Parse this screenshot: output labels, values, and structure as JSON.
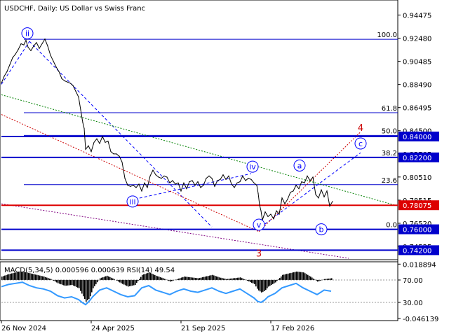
{
  "chart_data": [
    {
      "type": "line",
      "title": "USDCHF, Daily:  US Dollar vs Swiss Franc",
      "symbol": "USDCHF",
      "timeframe": "Daily",
      "ylim": [
        0.735,
        0.9565
      ],
      "y_ticks": [
        "0.94475",
        "0.92480",
        "0.90485",
        "0.88490",
        "0.86495",
        "0.84500",
        "0.82505",
        "0.80510",
        "0.78515",
        "0.76520",
        "0.74525"
      ],
      "x_ticks": [
        "26 Nov 2024",
        "24 Apr 2025",
        "21 Sep 2025",
        "17 Feb 2026"
      ],
      "price_series": {
        "name": "USDCHF",
        "x": [
          0,
          4,
          8,
          12,
          16,
          20,
          24,
          28,
          32,
          35,
          38,
          42,
          46,
          50,
          54,
          58,
          62,
          66,
          70,
          74,
          78,
          82,
          86,
          90,
          94,
          98,
          102,
          106,
          110,
          113,
          116,
          118,
          120,
          124,
          128,
          132,
          136,
          140,
          144,
          148,
          152,
          156,
          160,
          164,
          168,
          172,
          176,
          180,
          184,
          188,
          192,
          196,
          200,
          204,
          208,
          212,
          216,
          220,
          224,
          228,
          232,
          236,
          240,
          244,
          248,
          252,
          256,
          260,
          264,
          268,
          272,
          276,
          280,
          284,
          288,
          292,
          296,
          300,
          304,
          308,
          312,
          316,
          320,
          324,
          328,
          332,
          336,
          340,
          344,
          348,
          352,
          356,
          360,
          364,
          366,
          368,
          370,
          372,
          376,
          380,
          384,
          388,
          392,
          396,
          400,
          404,
          408,
          412,
          416,
          420,
          424,
          428,
          432,
          436,
          440,
          444,
          448,
          452,
          456,
          460,
          464,
          468,
          472
        ],
        "values": [
          0.886,
          0.892,
          0.896,
          0.902,
          0.908,
          0.911,
          0.915,
          0.92,
          0.919,
          0.923,
          0.917,
          0.914,
          0.918,
          0.921,
          0.916,
          0.92,
          0.924,
          0.918,
          0.91,
          0.905,
          0.9,
          0.896,
          0.89,
          0.888,
          0.887,
          0.886,
          0.884,
          0.879,
          0.874,
          0.863,
          0.852,
          0.847,
          0.829,
          0.832,
          0.827,
          0.835,
          0.838,
          0.834,
          0.84,
          0.835,
          0.836,
          0.827,
          0.825,
          0.825,
          0.823,
          0.818,
          0.804,
          0.798,
          0.797,
          0.798,
          0.796,
          0.799,
          0.793,
          0.8,
          0.796,
          0.806,
          0.811,
          0.807,
          0.805,
          0.804,
          0.806,
          0.805,
          0.8,
          0.802,
          0.799,
          0.8,
          0.793,
          0.8,
          0.795,
          0.801,
          0.802,
          0.798,
          0.801,
          0.796,
          0.798,
          0.804,
          0.806,
          0.804,
          0.797,
          0.802,
          0.803,
          0.807,
          0.803,
          0.806,
          0.799,
          0.796,
          0.8,
          0.801,
          0.806,
          0.802,
          0.804,
          0.803,
          0.8,
          0.798,
          0.791,
          0.781,
          0.776,
          0.768,
          0.775,
          0.771,
          0.773,
          0.769,
          0.776,
          0.773,
          0.787,
          0.782,
          0.786,
          0.792,
          0.793,
          0.798,
          0.795,
          0.801,
          0.8,
          0.806,
          0.802,
          0.805,
          0.79,
          0.787,
          0.794,
          0.788,
          0.793,
          0.78,
          0.784
        ]
      },
      "horizontal_levels": [
        {
          "value": 0.84,
          "label": "0.84000",
          "color": "#0000cc",
          "weight": "bold"
        },
        {
          "value": 0.822,
          "label": "0.82200",
          "color": "#0000cc",
          "weight": "bold"
        },
        {
          "value": 0.78075,
          "label": "0.78075",
          "color": "#dd0000",
          "weight": "bold"
        },
        {
          "value": 0.76,
          "label": "0.76000",
          "color": "#0000cc",
          "weight": "bold"
        },
        {
          "value": 0.742,
          "label": "0.74200",
          "color": "#0000cc",
          "weight": "bold"
        }
      ],
      "fibonacci_levels": [
        {
          "label": "100.0",
          "value": 0.9238
        },
        {
          "label": "61.8",
          "value": 0.8605
        },
        {
          "label": "50.0",
          "value": 0.841
        },
        {
          "label": "38.2",
          "value": 0.822
        },
        {
          "label": "23.6",
          "value": 0.7985
        },
        {
          "label": "0.0",
          "value": 0.76
        }
      ],
      "wave_labels": [
        {
          "text": "ii",
          "x": 37,
          "value": 0.929,
          "style": "circle-blue"
        },
        {
          "text": "iii",
          "x": 187,
          "value": 0.784,
          "style": "circle-blue"
        },
        {
          "text": "iv",
          "x": 358,
          "value": 0.814,
          "style": "circle-blue"
        },
        {
          "text": "v",
          "x": 367,
          "value": 0.764,
          "style": "circle-blue"
        },
        {
          "text": "a",
          "x": 425,
          "value": 0.815,
          "style": "circle-blue"
        },
        {
          "text": "b",
          "x": 456,
          "value": 0.76,
          "style": "circle-blue"
        },
        {
          "text": "c",
          "x": 512,
          "value": 0.834,
          "style": "circle-blue"
        },
        {
          "text": "3",
          "x": 367,
          "value": 0.7395,
          "style": "plain-red"
        },
        {
          "text": "4",
          "x": 512,
          "value": 0.848,
          "style": "plain-red"
        }
      ]
    },
    {
      "type": "line",
      "title": "MACD(5,34,5) 0.000596 0.000639 RSI(14) 49.54",
      "ylim": [
        -0.047,
        0.02
      ],
      "y_ticks": [
        "0.018894",
        "70.00",
        "30.00",
        "-0.046139"
      ],
      "macd_histogram": {
        "name": "MACD",
        "x": [
          0,
          10,
          20,
          30,
          40,
          50,
          60,
          70,
          80,
          90,
          100,
          110,
          115,
          120,
          125,
          130,
          140,
          150,
          160,
          170,
          180,
          190,
          200,
          210,
          220,
          230,
          240,
          250,
          260,
          270,
          280,
          290,
          300,
          310,
          320,
          330,
          340,
          350,
          360,
          365,
          370,
          375,
          380,
          390,
          400,
          410,
          420,
          430,
          440,
          450,
          460,
          470
        ],
        "values": [
          0.004,
          0.007,
          0.009,
          0.01,
          0.008,
          0.006,
          0.004,
          0.001,
          -0.004,
          -0.007,
          -0.006,
          -0.01,
          -0.018,
          -0.026,
          -0.022,
          -0.01,
          0.002,
          0.005,
          0.001,
          -0.004,
          -0.008,
          -0.006,
          0.006,
          0.009,
          0.005,
          0.002,
          -0.002,
          0.001,
          0.004,
          0.003,
          0.002,
          0.004,
          0.006,
          0.003,
          0.001,
          0.002,
          0.003,
          -0.001,
          -0.005,
          -0.012,
          -0.015,
          -0.013,
          -0.008,
          -0.003,
          0.006,
          0.008,
          0.01,
          0.009,
          0.004,
          -0.002,
          0.001,
          0.002
        ]
      },
      "rsi": {
        "name": "RSI",
        "x": [
          0,
          10,
          20,
          30,
          40,
          50,
          60,
          70,
          80,
          90,
          100,
          110,
          115,
          120,
          125,
          130,
          140,
          150,
          160,
          170,
          180,
          190,
          200,
          210,
          220,
          230,
          240,
          250,
          260,
          270,
          280,
          290,
          300,
          310,
          320,
          330,
          340,
          350,
          360,
          365,
          370,
          375,
          380,
          390,
          400,
          410,
          420,
          430,
          440,
          450,
          460,
          470
        ],
        "values": [
          58,
          62,
          64,
          66,
          60,
          56,
          54,
          50,
          42,
          38,
          40,
          35,
          30,
          26,
          32,
          40,
          52,
          56,
          50,
          44,
          40,
          42,
          56,
          60,
          52,
          48,
          44,
          50,
          54,
          50,
          48,
          52,
          56,
          50,
          46,
          50,
          54,
          46,
          38,
          32,
          30,
          34,
          40,
          46,
          56,
          60,
          64,
          56,
          50,
          44,
          52,
          50
        ]
      }
    }
  ],
  "macd_value_text": "MACD(5,34,5) 0.000596 0.000639 RSI(14) 49.54",
  "colors": {
    "price": "#000000",
    "level_blue": "#0000cc",
    "level_red": "#dd0000",
    "trend_blue": "#0000ff",
    "trend_red": "#cc0000",
    "trend_green": "#008000",
    "trend_purple": "#800080",
    "rsi": "#3399ff"
  }
}
